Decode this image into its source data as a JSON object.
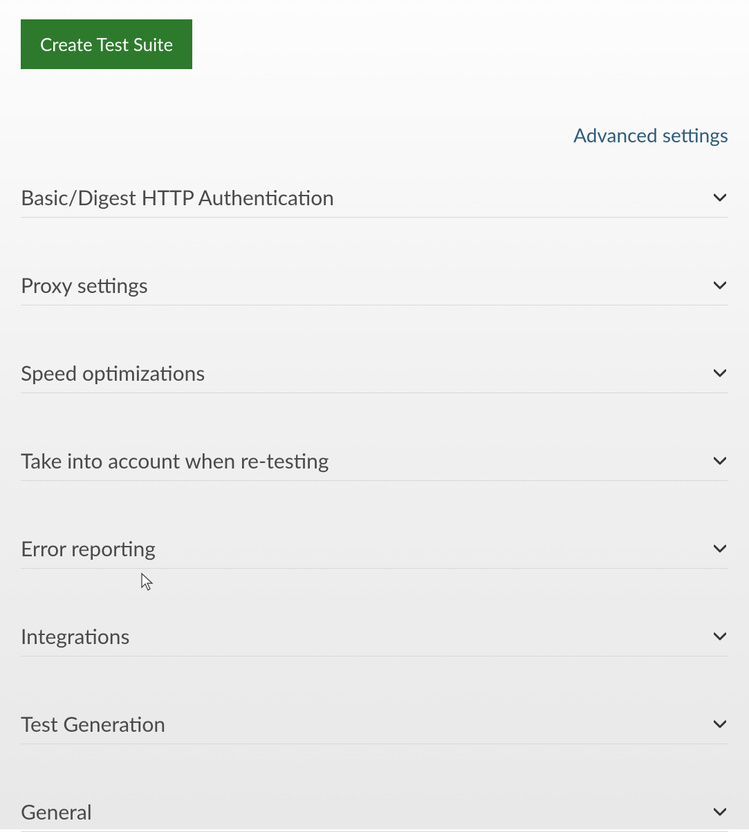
{
  "button": {
    "create_test_suite": "Create Test Suite"
  },
  "links": {
    "advanced_settings": "Advanced settings"
  },
  "sections": [
    {
      "label": "Basic/Digest HTTP Authentication"
    },
    {
      "label": "Proxy settings"
    },
    {
      "label": "Speed optimizations"
    },
    {
      "label": "Take into account when re-testing"
    },
    {
      "label": "Error reporting"
    },
    {
      "label": "Integrations"
    },
    {
      "label": "Test Generation"
    },
    {
      "label": "General"
    }
  ]
}
